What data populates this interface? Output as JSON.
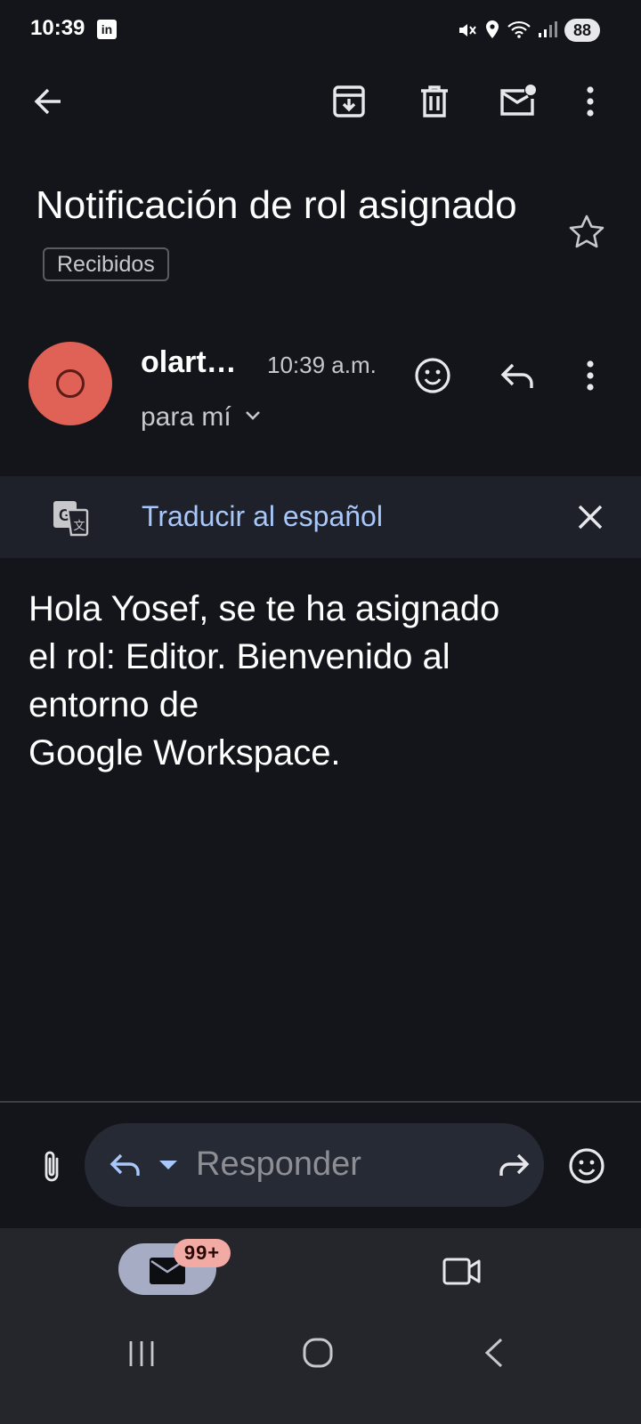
{
  "status_bar": {
    "time": "10:39",
    "app_badge": "in",
    "battery": "88"
  },
  "toolbar": {
    "icons": [
      "back-arrow-icon",
      "archive-icon",
      "trash-icon",
      "mark-unread-icon",
      "more-vert-icon"
    ]
  },
  "email": {
    "subject": "Notificación de rol asignado",
    "folder_chip": "Recibidos",
    "sender_initial": "O",
    "sender_name": "olart…",
    "time": "10:39 a.m.",
    "recipient": "para mí",
    "body_lines": [
      "Hola Yosef, se te ha asignado",
      "el rol: Editor. Bienvenido al",
      "entorno de",
      "Google Workspace."
    ]
  },
  "translate": {
    "label": "Traducir al español"
  },
  "reply": {
    "placeholder": "Responder"
  },
  "bottom_nav": {
    "mail_badge": "99+"
  },
  "colors": {
    "background": "#14151a",
    "avatar": "#e06155",
    "translate_link": "#a8c7fa",
    "badge": "#f1aaa4"
  }
}
